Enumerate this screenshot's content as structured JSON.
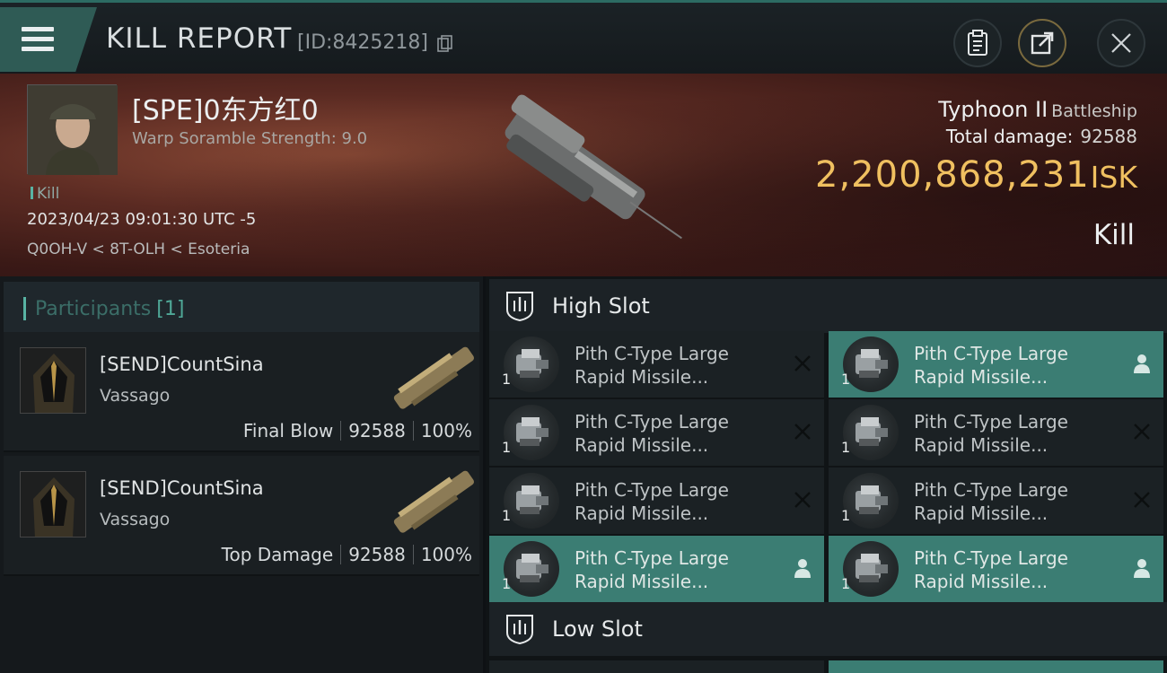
{
  "header": {
    "title": "KILL REPORT",
    "report_id": "[ID:8425218]",
    "menu_icon": "hamburger-icon",
    "actions": [
      {
        "name": "clipboard-icon"
      },
      {
        "name": "share-icon"
      },
      {
        "name": "close-icon"
      }
    ]
  },
  "victim": {
    "name": "[SPE]0东方红0",
    "warp_scramble": "Warp Soramble Strength: 9.0",
    "tag": "Kill",
    "datetime": "2023/04/23 09:01:30 UTC -5",
    "location": "Q0OH-V < 8T-OLH < Esoteria",
    "ship_name": "Typhoon II",
    "ship_class": "Battleship",
    "total_damage_label": "Total damage:",
    "total_damage": "92588",
    "isk_value": "2,200,868,231",
    "isk_unit": "ISK",
    "result": "Kill"
  },
  "participants": {
    "label": "Participants",
    "count": "[1]",
    "rows": [
      {
        "name": "[SEND]CountSina",
        "ship": "Vassago",
        "role": "Final Blow",
        "damage": "92588",
        "percent": "100%"
      },
      {
        "name": "[SEND]CountSina",
        "ship": "Vassago",
        "role": "Top Damage",
        "damage": "92588",
        "percent": "100%"
      }
    ]
  },
  "high_slot": {
    "label": "High Slot",
    "modules": [
      {
        "line1": "Pith C-Type Large",
        "line2": "Rapid Missile...",
        "qty": "1",
        "state": "destroyed"
      },
      {
        "line1": "Pith C-Type Large",
        "line2": "Rapid Missile...",
        "qty": "1",
        "state": "dropped"
      },
      {
        "line1": "Pith C-Type Large",
        "line2": "Rapid Missile...",
        "qty": "1",
        "state": "destroyed"
      },
      {
        "line1": "Pith C-Type Large",
        "line2": "Rapid Missile...",
        "qty": "1",
        "state": "destroyed"
      },
      {
        "line1": "Pith C-Type Large",
        "line2": "Rapid Missile...",
        "qty": "1",
        "state": "destroyed"
      },
      {
        "line1": "Pith C-Type Large",
        "line2": "Rapid Missile...",
        "qty": "1",
        "state": "destroyed"
      },
      {
        "line1": "Pith C-Type Large",
        "line2": "Rapid Missile...",
        "qty": "1",
        "state": "dropped"
      },
      {
        "line1": "Pith C-Type Large",
        "line2": "Rapid Missile...",
        "qty": "1",
        "state": "dropped"
      }
    ]
  },
  "low_slot": {
    "label": "Low Slot"
  },
  "colors": {
    "accent": "#58b3a3",
    "selected": "#3b7d73",
    "isk": "#f0c060"
  }
}
